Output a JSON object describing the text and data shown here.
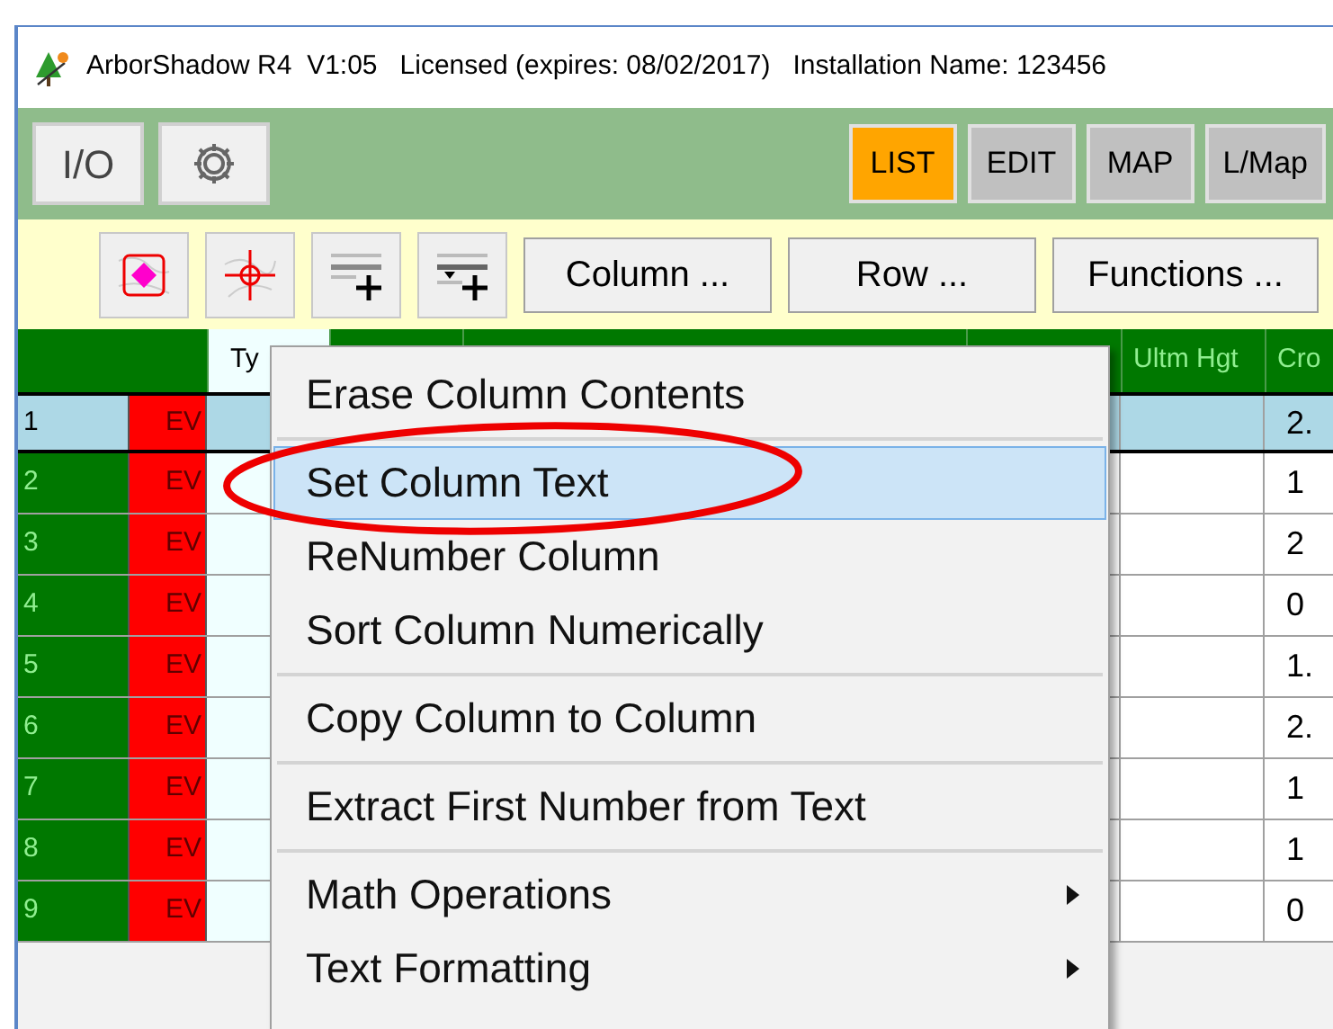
{
  "window": {
    "title": "ArborShadow R4  V1:05   Licensed (expires: 08/02/2017)   Installation Name: 123456"
  },
  "main_toolbar": {
    "left_buttons": [
      {
        "kind": "text",
        "label": "I/O"
      },
      {
        "kind": "gear"
      }
    ],
    "mode_tabs": [
      {
        "label": "LIST",
        "selected": true
      },
      {
        "label": "EDIT",
        "selected": false
      },
      {
        "label": "MAP",
        "selected": false
      },
      {
        "label": "L/Map",
        "selected": false
      }
    ]
  },
  "list_toolbar": {
    "icon_buttons": [
      {
        "kind": "marker"
      },
      {
        "kind": "crosshair"
      },
      {
        "kind": "add_row"
      },
      {
        "kind": "insert_row"
      }
    ],
    "buttons": [
      "Column ...",
      "Row ...",
      "Functions ..."
    ]
  },
  "table": {
    "header": {
      "column_3": "Ty",
      "column_7": "Ultm Hgt",
      "column_8": "Cro"
    },
    "rows": [
      {
        "number": "1",
        "code": "EV",
        "crown": "2.",
        "selected": true
      },
      {
        "number": "2",
        "code": "EV",
        "crown": "1",
        "selected": false
      },
      {
        "number": "3",
        "code": "EV",
        "crown": "2",
        "selected": false
      },
      {
        "number": "4",
        "code": "EV",
        "crown": "0",
        "selected": false
      },
      {
        "number": "5",
        "code": "EV",
        "crown": "1.",
        "selected": false
      },
      {
        "number": "6",
        "code": "EV",
        "crown": "2.",
        "selected": false
      },
      {
        "number": "7",
        "code": "EV",
        "crown": "1",
        "selected": false
      },
      {
        "number": "8",
        "code": "EV",
        "crown": "1",
        "selected": false
      },
      {
        "number": "9",
        "code": "EV",
        "crown": "0",
        "selected": false
      }
    ]
  },
  "context_menu": {
    "items": [
      {
        "kind": "item",
        "label": "Erase Column Contents",
        "selected": false,
        "has_submenu": false
      },
      {
        "kind": "separator"
      },
      {
        "kind": "item",
        "label": "Set Column Text",
        "selected": true,
        "has_submenu": false
      },
      {
        "kind": "item",
        "label": "ReNumber Column",
        "selected": false,
        "has_submenu": false
      },
      {
        "kind": "item",
        "label": "Sort Column Numerically",
        "selected": false,
        "has_submenu": false
      },
      {
        "kind": "separator"
      },
      {
        "kind": "item",
        "label": "Copy Column to Column",
        "selected": false,
        "has_submenu": false
      },
      {
        "kind": "separator"
      },
      {
        "kind": "item",
        "label": "Extract First Number from Text",
        "selected": false,
        "has_submenu": false
      },
      {
        "kind": "separator"
      },
      {
        "kind": "item",
        "label": "Math Operations",
        "selected": false,
        "has_submenu": true
      },
      {
        "kind": "item",
        "label": "Text Formatting",
        "selected": false,
        "has_submenu": true
      }
    ]
  }
}
